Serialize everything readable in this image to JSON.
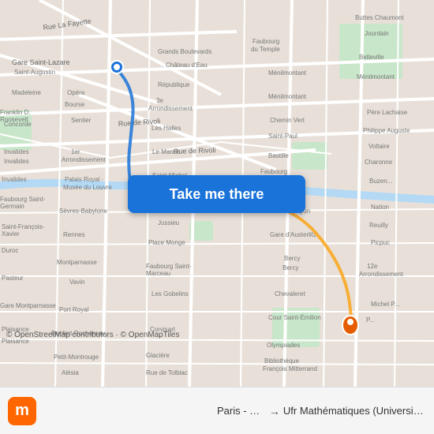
{
  "map": {
    "attribution": "© OpenStreetMap contributors · © OpenMapTiles",
    "background_color": "#e8e0d8",
    "center": "Paris, France"
  },
  "button": {
    "label": "Take me there"
  },
  "bottom_bar": {
    "origin": "Paris - Opé...",
    "arrow": "→",
    "destination": "Ufr Mathématiques (Université de Pa...",
    "logo_letter": "m"
  }
}
